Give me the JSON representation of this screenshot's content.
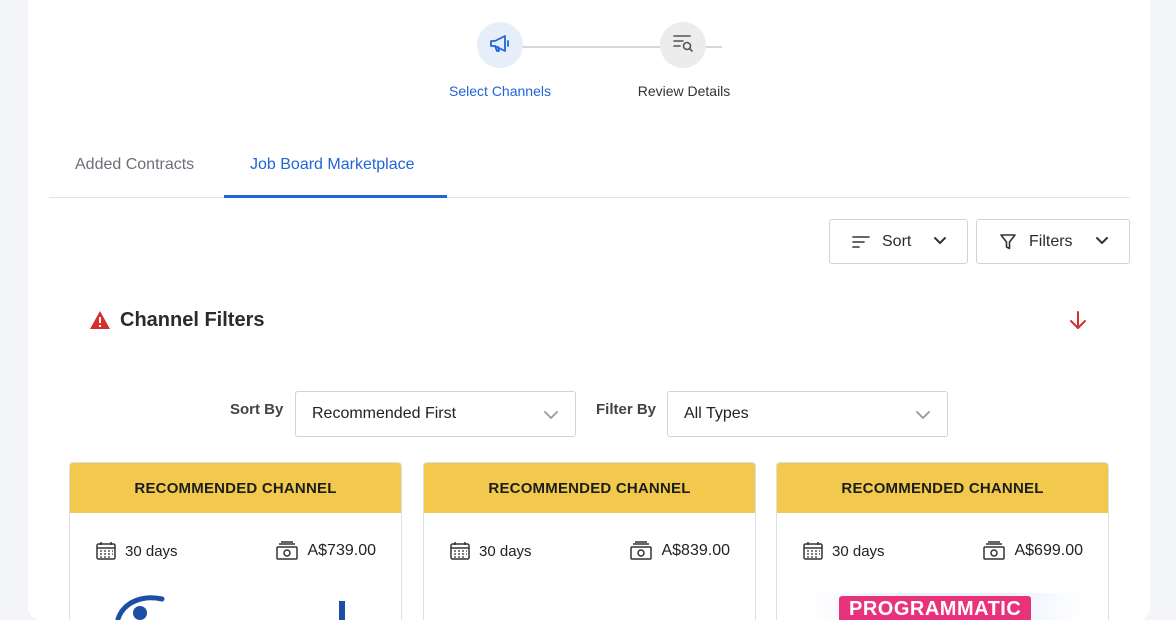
{
  "stepper": {
    "steps": [
      {
        "label": "Select Channels",
        "icon": "megaphone-icon",
        "state": "active"
      },
      {
        "label": "Review Details",
        "icon": "review-list-icon",
        "state": "inactive"
      }
    ]
  },
  "tabs": [
    {
      "label": "Added Contracts",
      "active": false
    },
    {
      "label": "Job Board Marketplace",
      "active": true
    }
  ],
  "toolbar": {
    "sort_label": "Sort",
    "filters_label": "Filters"
  },
  "channel_filters": {
    "title": "Channel Filters",
    "sort_by_label": "Sort By",
    "sort_by_value": "Recommended First",
    "filter_by_label": "Filter By",
    "filter_by_value": "All Types"
  },
  "cards": [
    {
      "header": "RECOMMENDED CHANNEL",
      "duration": "30 days",
      "price": "A$739.00",
      "logo": "indeed-logo"
    },
    {
      "header": "RECOMMENDED CHANNEL",
      "duration": "30 days",
      "price": "A$839.00",
      "logo": ""
    },
    {
      "header": "RECOMMENDED CHANNEL",
      "duration": "30 days",
      "price": "A$699.00",
      "badge": "PROGRAMMATIC"
    }
  ],
  "colors": {
    "accent": "#2165d6",
    "warning": "#d32f2f",
    "card_header": "#f2c94c",
    "badge": "#e8327a"
  }
}
